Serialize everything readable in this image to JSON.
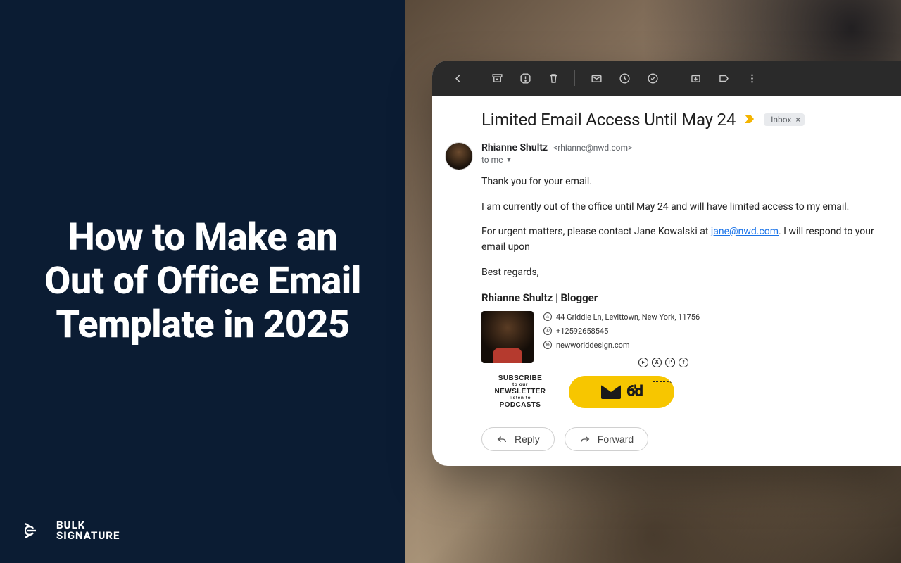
{
  "hero": {
    "headline": "How to Make an Out of Office Email Template in 2025"
  },
  "brand": {
    "line1": "BULK",
    "line2": "SIGNATURE"
  },
  "mail": {
    "subject": "Limited Email Access Until May 24",
    "inbox_chip": "Inbox",
    "sender_name": "Rhianne Shultz",
    "sender_email": "<rhianne@nwd.com>",
    "to_label": "to me",
    "body": {
      "p1": "Thank you for your email.",
      "p2": "I am currently out of the office until May 24 and will have limited access to my email.",
      "p3_before": "For urgent matters, please contact Jane Kowalski at ",
      "p3_link": "jane@nwd.com",
      "p3_after": ". I will respond to your email upon",
      "closing": "Best regards,"
    },
    "signature": {
      "name": "Rhianne Shultz",
      "separator": " | ",
      "role": "Blogger",
      "address": "44 Griddle Ln, Levittown, New York, 11756",
      "phone": "+12592658545",
      "website": "newworlddesign.com",
      "socials": [
        "youtube",
        "x",
        "pinterest",
        "facebook"
      ]
    },
    "banner": {
      "subscribe": "SUBSCRIBE",
      "sub_small1": "to our",
      "newsletter": "NEWSLETTER",
      "sub_small2": "listen to",
      "podcasts": "PODCASTS"
    },
    "actions": {
      "reply": "Reply",
      "forward": "Forward"
    }
  }
}
